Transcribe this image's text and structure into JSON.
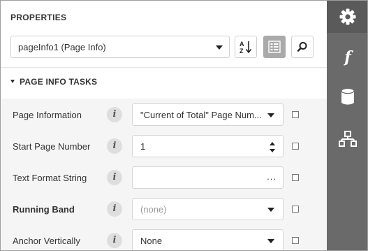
{
  "panel": {
    "title": "PROPERTIES",
    "component_select": {
      "value": "pageInfo1 (Page Info)"
    },
    "toolbar": {
      "sort_icon": "sort-alphabetical-icon",
      "categories_icon": "categorized-view-icon",
      "search_icon": "search-icon"
    },
    "section": {
      "title": "PAGE INFO TASKS"
    },
    "rows": [
      {
        "label": "Page Information",
        "value": "\"Current of Total\" Page Num...",
        "editor": "dropdown",
        "bold": false
      },
      {
        "label": "Start Page Number",
        "value": "1",
        "editor": "spin",
        "bold": false
      },
      {
        "label": "Text Format String",
        "value": "",
        "editor": "ellipsis",
        "bold": false
      },
      {
        "label": "Running Band",
        "value": "(none)",
        "editor": "dropdown",
        "bold": true,
        "placeholder": true
      },
      {
        "label": "Anchor Vertically",
        "value": "None",
        "editor": "dropdown",
        "bold": false
      }
    ],
    "ellipsis_text": "...",
    "info_glyph": "i"
  },
  "sidebar": {
    "items": [
      {
        "name": "properties",
        "icon": "gear-icon",
        "active": true
      },
      {
        "name": "expressions",
        "icon": "function-icon",
        "glyph": "f",
        "active": false
      },
      {
        "name": "data-source",
        "icon": "database-icon",
        "active": false
      },
      {
        "name": "report-explorer",
        "icon": "hierarchy-icon",
        "active": false
      }
    ]
  },
  "colors": {
    "sidebar_bg": "#6a6a6a",
    "sidebar_active": "#5a5a5a",
    "grid_bg": "#f5f5f5",
    "active_toolbar_btn": "#aaaaaa"
  }
}
